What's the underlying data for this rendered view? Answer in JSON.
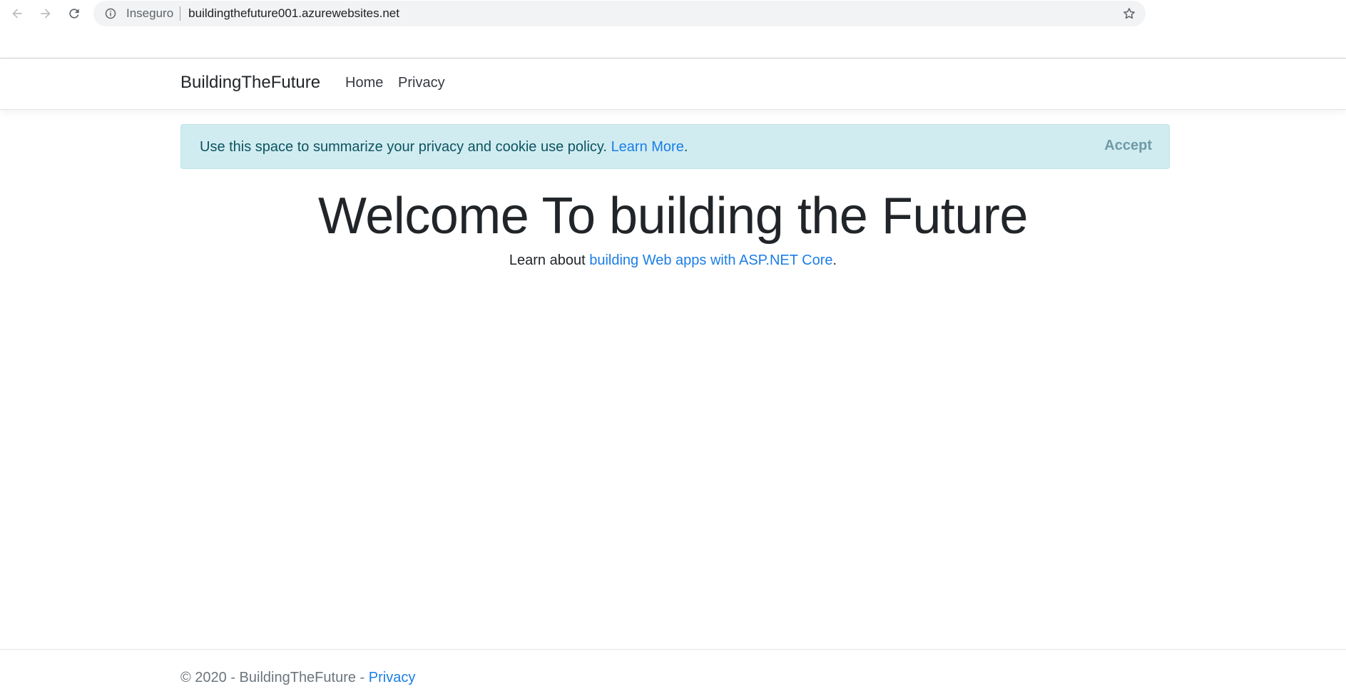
{
  "browser": {
    "security_label": "Inseguro",
    "url": "buildingthefuture001.azurewebsites.net",
    "icons": {
      "back": "arrow-left-icon",
      "forward": "arrow-right-icon",
      "reload": "reload-icon",
      "info": "info-icon",
      "bookmark": "star-icon"
    }
  },
  "header": {
    "brand": "BuildingTheFuture",
    "nav": [
      {
        "label": "Home"
      },
      {
        "label": "Privacy"
      }
    ]
  },
  "cookie_notice": {
    "text": "Use this space to summarize your privacy and cookie use policy.",
    "link_label": "Learn More",
    "link_suffix": ".",
    "accept_label": "Accept"
  },
  "main": {
    "title": "Welcome To building the Future",
    "learn_prefix": "Learn about",
    "learn_link": "building Web apps with ASP.NET Core",
    "learn_suffix": "."
  },
  "footer": {
    "text": "© 2020 - BuildingTheFuture -",
    "link_label": "Privacy"
  },
  "colors": {
    "link": "#1b7ee6",
    "alert_bg": "#d1ecf1",
    "alert_text": "#0c5460",
    "accept_text": "#6f9ba5"
  }
}
